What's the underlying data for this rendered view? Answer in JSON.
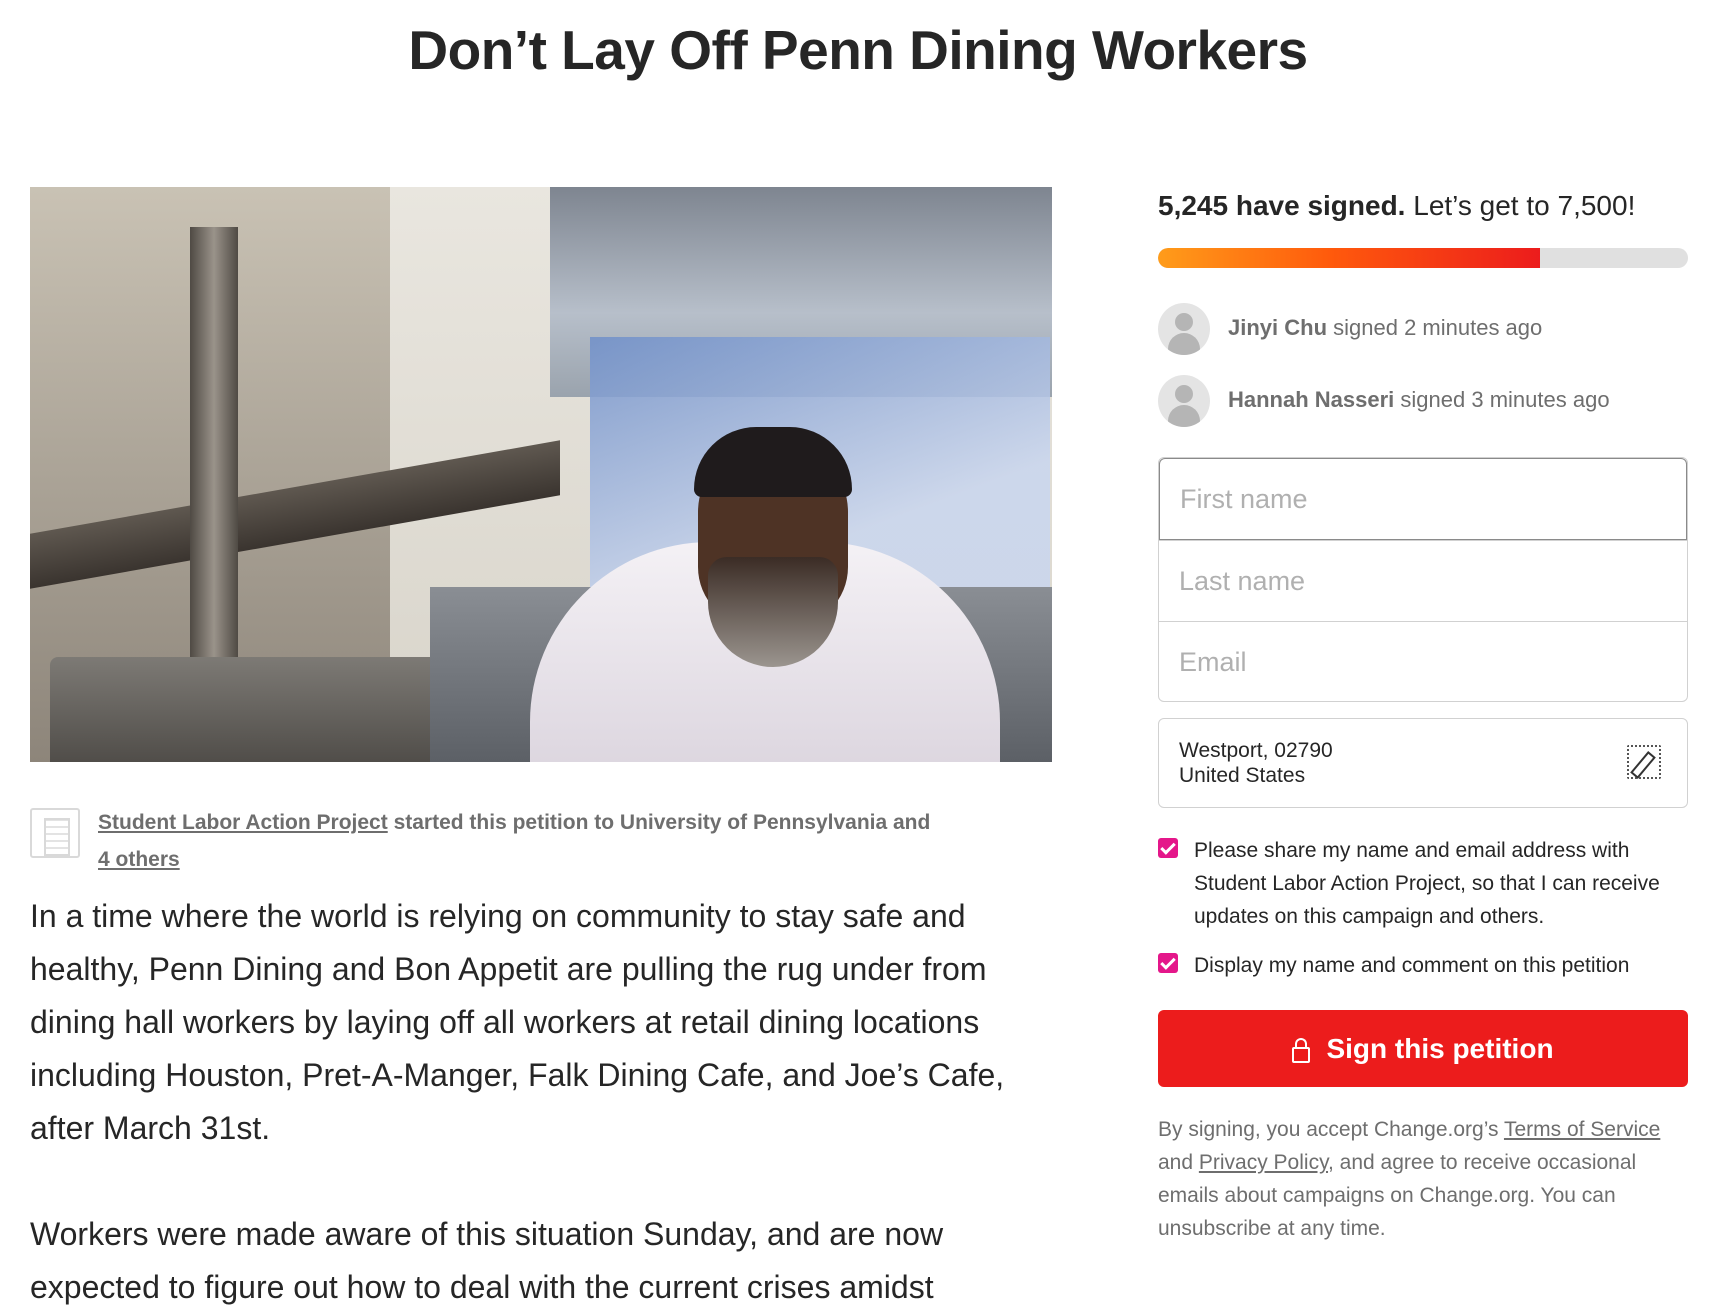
{
  "page": {
    "title": "Don’t Lay Off Penn Dining Workers"
  },
  "petition": {
    "starter_name": "Student Labor Action Project",
    "started_text": " started this petition to University of Pennsylvania and ",
    "others_link": "4 others",
    "paragraphs": [
      "In a time where the world is relying on community to stay safe and healthy, Penn Dining and Bon Appetit are pulling the rug under from dining hall workers by laying off all workers at retail dining locations including Houston, Pret-A-Manger, Falk Dining Cafe, and Joe’s Cafe, after March 31st.",
      "Workers were made aware of this situation Sunday, and are now expected to figure out how to deal with the current crises amidst"
    ]
  },
  "sign_panel": {
    "signed_count": "5,245 have signed.",
    "goal_text": " Let’s get to 7,500!",
    "progress_fraction": 0.72,
    "progress_color_start": "#ff9c1a",
    "progress_color_end": "#ec1c1c",
    "recent_signers": [
      {
        "name": "Jinyi Chu",
        "action": " signed 2 minutes ago"
      },
      {
        "name": "Hannah Nasseri",
        "action": " signed 3 minutes ago"
      }
    ],
    "fields": {
      "first_name_placeholder": "First name",
      "last_name_placeholder": "Last name",
      "email_placeholder": "Email"
    },
    "location": {
      "line1": "Westport, 02790",
      "line2": "United States"
    },
    "checkboxes": [
      {
        "label": "Please share my name and email address with Student Labor Action Project, so that I can receive updates on this campaign and others.",
        "checked": true
      },
      {
        "label": "Display my name and comment on this petition",
        "checked": true
      }
    ],
    "checkbox_color": "#e4178a",
    "button_label": "Sign this petition",
    "button_color": "#ec1c1c",
    "legal": {
      "prefix": "By signing, you accept Change.org’s ",
      "terms_link": "Terms of Service",
      "middle": " and ",
      "privacy_link": "Privacy Policy",
      "suffix": ", and agree to receive occasional emails about campaigns on Change.org. You can unsubscribe at any time."
    }
  }
}
